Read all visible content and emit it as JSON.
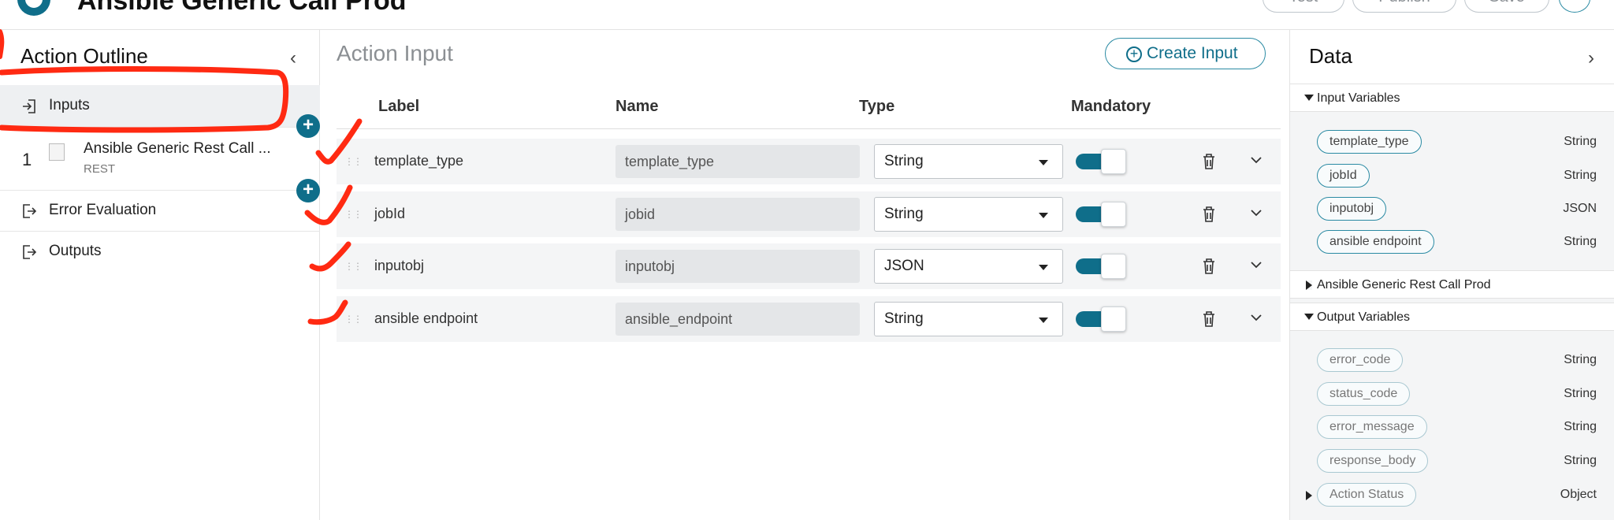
{
  "header": {
    "app_title": "Ansible Generic Call Prod",
    "buttons": [
      "Test",
      "Publish",
      "Save"
    ]
  },
  "left_panel": {
    "title": "Action Outline",
    "items": [
      {
        "label": "Inputs",
        "icon": "login-icon",
        "active": true
      },
      {
        "number": "1",
        "name": "Ansible Generic Rest Call ...",
        "subtitle": "REST"
      },
      {
        "label": "Error Evaluation",
        "icon": "logout-icon"
      },
      {
        "label": "Outputs",
        "icon": "logout-icon"
      }
    ]
  },
  "center": {
    "title": "Action Input",
    "create_button": "Create Input",
    "columns": [
      "Label",
      "Name",
      "Type",
      "Mandatory"
    ],
    "rows": [
      {
        "label": "template_type",
        "name": "template_type",
        "type": "String",
        "mandatory": true
      },
      {
        "label": "jobId",
        "name": "jobid",
        "type": "String",
        "mandatory": true
      },
      {
        "label": "inputobj",
        "name": "inputobj",
        "type": "JSON",
        "mandatory": true
      },
      {
        "label": "ansible endpoint",
        "name": "ansible_endpoint",
        "type": "String",
        "mandatory": true
      }
    ]
  },
  "right_panel": {
    "title": "Data",
    "input_section": "Input Variables",
    "input_vars": [
      {
        "name": "template_type",
        "type": "String"
      },
      {
        "name": "jobId",
        "type": "String"
      },
      {
        "name": "inputobj",
        "type": "JSON"
      },
      {
        "name": "ansible endpoint",
        "type": "String"
      }
    ],
    "step_section": "Ansible Generic Rest Call Prod",
    "output_section": "Output Variables",
    "output_vars": [
      {
        "name": "error_code",
        "type": "String"
      },
      {
        "name": "status_code",
        "type": "String"
      },
      {
        "name": "error_message",
        "type": "String"
      },
      {
        "name": "response_body",
        "type": "String"
      },
      {
        "name": "Action Status",
        "type": "Object"
      }
    ]
  },
  "colors": {
    "accent": "#0f6e8a",
    "annotation": "#ff2a12"
  }
}
